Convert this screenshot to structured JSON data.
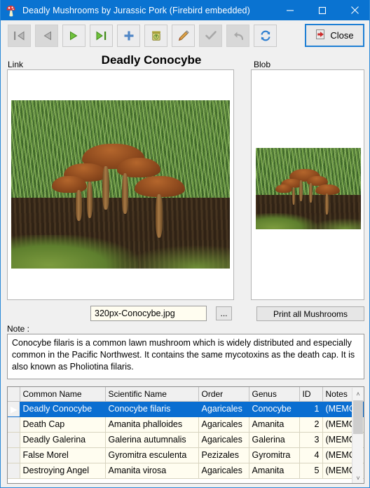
{
  "window": {
    "title": "Deadly Mushrooms by Jurassic Pork (Firebird embedded)",
    "icon": "mushroom-icon",
    "accent_color": "#0a73d1",
    "controls": {
      "minimize": "—",
      "maximize": "☐",
      "close": "✕"
    }
  },
  "toolbar": {
    "buttons": [
      {
        "name": "first-record",
        "icon": "arrow-first-icon",
        "enabled": false
      },
      {
        "name": "prior-record",
        "icon": "arrow-left-icon",
        "enabled": false
      },
      {
        "name": "next-record",
        "icon": "arrow-right-icon",
        "enabled": true
      },
      {
        "name": "last-record",
        "icon": "arrow-last-icon",
        "enabled": true
      },
      {
        "name": "insert-record",
        "icon": "plus-icon",
        "enabled": true
      },
      {
        "name": "delete-record",
        "icon": "trash-icon",
        "enabled": true
      },
      {
        "name": "edit-record",
        "icon": "pencil-icon",
        "enabled": true
      },
      {
        "name": "post-record",
        "icon": "check-icon",
        "enabled": false
      },
      {
        "name": "cancel-edit",
        "icon": "undo-icon",
        "enabled": false
      },
      {
        "name": "refresh-data",
        "icon": "refresh-icon",
        "enabled": true
      }
    ],
    "close_label": "Close",
    "close_icon": "exit-door-icon"
  },
  "record": {
    "heading": "Deadly Conocybe",
    "link_group_label": "Link",
    "blob_group_label": "Blob",
    "filename": "320px-Conocybe.jpg",
    "filename_placeholder": "",
    "browse_label": "...",
    "print_label": "Print all Mushrooms",
    "note_label": "Note :",
    "note_text": "Conocybe filaris is a common lawn mushroom which is widely distributed and especially common in the Pacific Northwest. It contains the same mycotoxins as the death cap. It is also known as Pholiotina filaris."
  },
  "grid": {
    "columns": [
      "Common Name",
      "Scientific Name",
      "Order",
      "Genus",
      "ID",
      "Notes"
    ],
    "selected_index": 0,
    "row_indicator": "▶",
    "rows": [
      {
        "common": "Deadly Conocybe",
        "scientific": "Conocybe filaris",
        "order": "Agaricales",
        "genus": "Conocybe",
        "id": "1",
        "notes": "(MEMO)"
      },
      {
        "common": "Death Cap",
        "scientific": "Amanita phalloides",
        "order": "Agaricales",
        "genus": "Amanita",
        "id": "2",
        "notes": "(MEMO)"
      },
      {
        "common": "Deadly Galerina",
        "scientific": "Galerina autumnalis",
        "order": "Agaricales",
        "genus": "Galerina",
        "id": "3",
        "notes": "(MEMO)"
      },
      {
        "common": "False Morel",
        "scientific": "Gyromitra esculenta",
        "order": "Pezizales",
        "genus": "Gyromitra",
        "id": "4",
        "notes": "(MEMO)"
      },
      {
        "common": "Destroying Angel",
        "scientific": "Amanita virosa",
        "order": "Agaricales",
        "genus": "Amanita",
        "id": "5",
        "notes": "(MEMO)"
      }
    ],
    "scrollbar": {
      "up": "˄",
      "down": "˅"
    }
  }
}
